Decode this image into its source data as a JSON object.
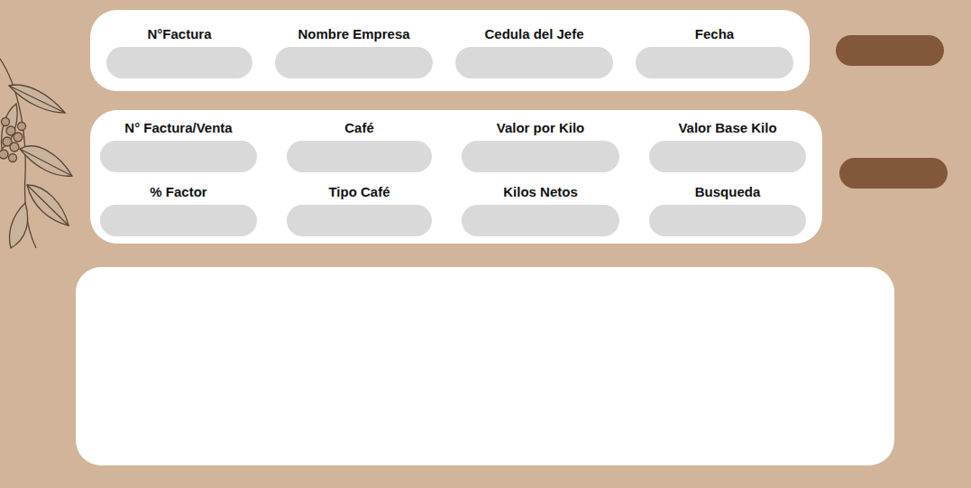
{
  "header_fields": [
    {
      "label": "N°Factura"
    },
    {
      "label": "Nombre Empresa"
    },
    {
      "label": "Cedula del Jefe"
    },
    {
      "label": "Fecha"
    }
  ],
  "sale_fields": [
    {
      "label": "N° Factura/Venta"
    },
    {
      "label": "Café"
    },
    {
      "label": "Valor por Kilo"
    },
    {
      "label": "Valor Base Kilo"
    },
    {
      "label": "% Factor"
    },
    {
      "label": "Tipo Café"
    },
    {
      "label": "Kilos Netos"
    },
    {
      "label": "Busqueda"
    }
  ]
}
